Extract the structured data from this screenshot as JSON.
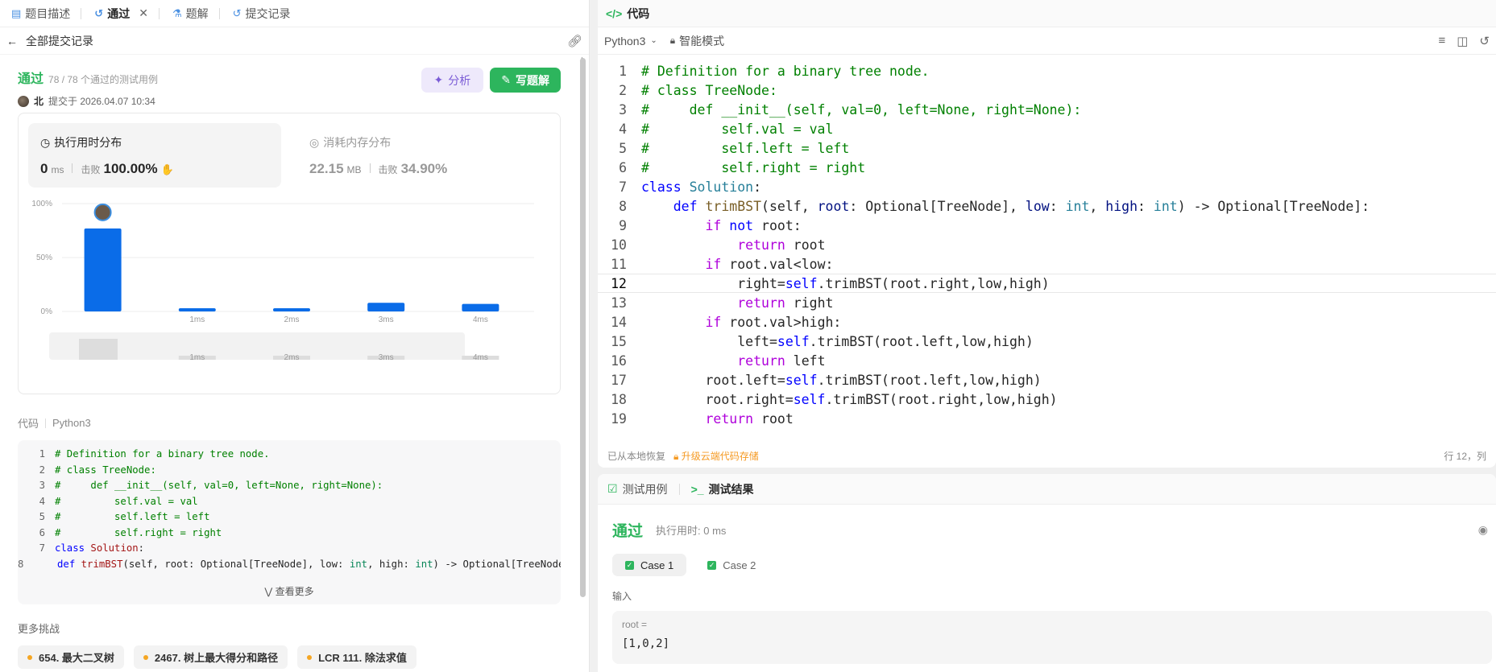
{
  "left_tabs": [
    {
      "label": "题目描述",
      "icon": "document-icon"
    },
    {
      "label": "通过",
      "icon": "history-icon",
      "active": true
    },
    {
      "label": "题解",
      "icon": "flask-icon"
    },
    {
      "label": "提交记录",
      "icon": "history-icon"
    }
  ],
  "back_label": "全部提交记录",
  "submission": {
    "status": "通过",
    "cases": "78 / 78 个通过的测试用例",
    "user": "北",
    "submitted_at": "提交于 2026.04.07 10:34",
    "analyze_label": "分析",
    "write_label": "写题解"
  },
  "runtime": {
    "title": "执行用时分布",
    "value": "0",
    "unit": "ms",
    "beats_label": "击败",
    "beats": "100.00%"
  },
  "memory": {
    "title": "消耗内存分布",
    "value": "22.15",
    "unit": "MB",
    "beats_label": "击败",
    "beats": "34.90%"
  },
  "chart_data": {
    "type": "bar",
    "categories": [
      "0ms",
      "1ms",
      "2ms",
      "3ms",
      "4ms"
    ],
    "values": [
      77,
      3,
      3,
      8,
      7
    ],
    "tick_labels": [
      "",
      "1ms",
      "2ms",
      "3ms",
      "4ms"
    ],
    "y_ticks": [
      "100%",
      "50%",
      "0%"
    ],
    "ylim": [
      0,
      100
    ],
    "highlight_index": 0,
    "bar_color": "#0a6ce8",
    "grid": true
  },
  "code_section": {
    "label": "代码",
    "lang": "Python3",
    "more_label": "查看更多"
  },
  "more_challenges": {
    "label": "更多挑战",
    "items": [
      "654. 最大二叉树",
      "2467. 树上最大得分和路径",
      "LCR 111. 除法求值"
    ]
  },
  "editor": {
    "title": "代码",
    "language": "Python3",
    "mode": "智能模式",
    "restored": "已从本地恢复",
    "upgrade": "升级云端代码存储",
    "cursor": "行 12，列",
    "current_line": 12
  },
  "code_lines": [
    [
      [
        "# Definition for a binary tree node.",
        "cm"
      ]
    ],
    [
      [
        "# class TreeNode:",
        "cm"
      ]
    ],
    [
      [
        "#     def __init__(self, val=0, left=None, right=None):",
        "cm"
      ]
    ],
    [
      [
        "#         self.val = val",
        "cm"
      ]
    ],
    [
      [
        "#         self.left = left",
        "cm"
      ]
    ],
    [
      [
        "#         self.right = right",
        "cm"
      ]
    ],
    [
      [
        "class ",
        "kw"
      ],
      [
        "Solution",
        "cls"
      ],
      [
        ":",
        ""
      ]
    ],
    [
      [
        "    ",
        ""
      ],
      [
        "def ",
        "kw"
      ],
      [
        "trimBST",
        "fn"
      ],
      [
        "(self, ",
        ""
      ],
      [
        "root",
        "pm"
      ],
      [
        ": Optional[TreeNode], ",
        ""
      ],
      [
        "low",
        "pm"
      ],
      [
        ": ",
        ""
      ],
      [
        "int",
        "ty"
      ],
      [
        ", ",
        ""
      ],
      [
        "high",
        "pm"
      ],
      [
        ": ",
        ""
      ],
      [
        "int",
        "ty"
      ],
      [
        ") -> Optional[TreeNode]:",
        ""
      ]
    ],
    [
      [
        "        ",
        ""
      ],
      [
        "if ",
        "ctl"
      ],
      [
        "not ",
        "kw"
      ],
      [
        "root:",
        ""
      ]
    ],
    [
      [
        "            ",
        ""
      ],
      [
        "return ",
        "ctl"
      ],
      [
        "root",
        ""
      ]
    ],
    [
      [
        "        ",
        ""
      ],
      [
        "if ",
        "ctl"
      ],
      [
        "root.val<low:",
        ""
      ]
    ],
    [
      [
        "            right=",
        ""
      ],
      [
        "self",
        "slf"
      ],
      [
        ".trimBST(root.right,low,high)",
        ""
      ]
    ],
    [
      [
        "            ",
        ""
      ],
      [
        "return ",
        "ctl"
      ],
      [
        "right",
        ""
      ]
    ],
    [
      [
        "        ",
        ""
      ],
      [
        "if ",
        "ctl"
      ],
      [
        "root.val>high:",
        ""
      ]
    ],
    [
      [
        "            left=",
        ""
      ],
      [
        "self",
        "slf"
      ],
      [
        ".trimBST(root.left,low,high)",
        ""
      ]
    ],
    [
      [
        "            ",
        ""
      ],
      [
        "return ",
        "ctl"
      ],
      [
        "left",
        ""
      ]
    ],
    [
      [
        "        root.left=",
        ""
      ],
      [
        "self",
        "slf"
      ],
      [
        ".trimBST(root.left,low,high)",
        ""
      ]
    ],
    [
      [
        "        root.right=",
        ""
      ],
      [
        "self",
        "slf"
      ],
      [
        ".trimBST(root.right,low,high)",
        ""
      ]
    ],
    [
      [
        "        ",
        ""
      ],
      [
        "return ",
        "ctl"
      ],
      [
        "root",
        ""
      ]
    ]
  ],
  "results": {
    "tab_testcase": "测试用例",
    "tab_result": "测试结果",
    "status": "通过",
    "runtime": "执行用时: 0 ms",
    "cases": [
      "Case 1",
      "Case 2"
    ],
    "input_label": "输入",
    "input_key": "root =",
    "input_value": "[1,0,2]"
  }
}
